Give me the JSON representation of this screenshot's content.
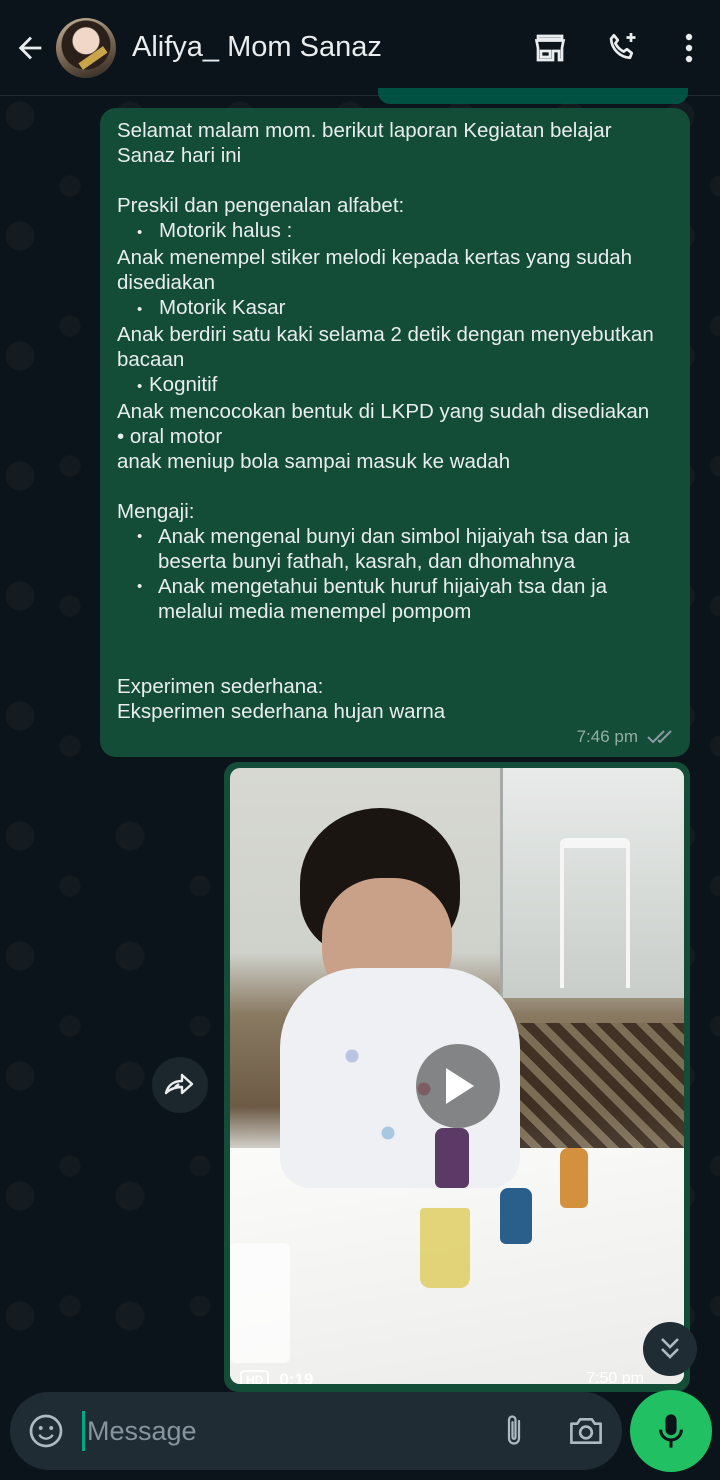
{
  "header": {
    "contact_name": "Alifya_ Mom Sanaz",
    "icons": [
      "back-arrow-icon",
      "avatar",
      "shop-icon",
      "add-call-icon",
      "more-vert-icon"
    ]
  },
  "message": {
    "intro": "Selamat malam mom. berikut laporan Kegiatan belajar Sanaz hari ini",
    "preskil_title": "Preskil dan pengenalan alfabet:",
    "motorik_halus_label": "Motorik halus :",
    "motorik_halus_text": "Anak menempel stiker melodi kepada kertas yang sudah disediakan",
    "motorik_kasar_label": "Motorik Kasar",
    "motorik_kasar_text": "Anak berdiri satu kaki selama 2 detik dengan menyebutkan bacaan",
    "kognitif_label": "Kognitif",
    "kognitif_text": "Anak mencocokan bentuk di LKPD yang sudah disediakan",
    "oral_motor_label": "• oral motor",
    "oral_motor_text": "anak meniup bola sampai masuk ke wadah",
    "mengaji_title": "Mengaji:",
    "mengaji_items": [
      "Anak mengenal bunyi dan simbol hijaiyah tsa dan ja beserta bunyi fathah, kasrah, dan dhomahnya",
      "Anak mengetahui bentuk huruf hijaiyah tsa dan ja melalui media menempel pompom"
    ],
    "eksperimen_title": "Experimen sederhana:",
    "eksperimen_text": "Eksperimen sederhana hujan warna",
    "time": "7:46 pm",
    "status": "read"
  },
  "video_message": {
    "quality_badge": "HD",
    "duration": "0:19",
    "time": "7:50 pm"
  },
  "composer": {
    "placeholder": "Message"
  },
  "colors": {
    "background": "#0b141a",
    "outgoing_bubble": "#134d37",
    "input_bar": "#1f2c33",
    "mic_button": "#21c063",
    "read_tick": "#8a9aa3"
  }
}
